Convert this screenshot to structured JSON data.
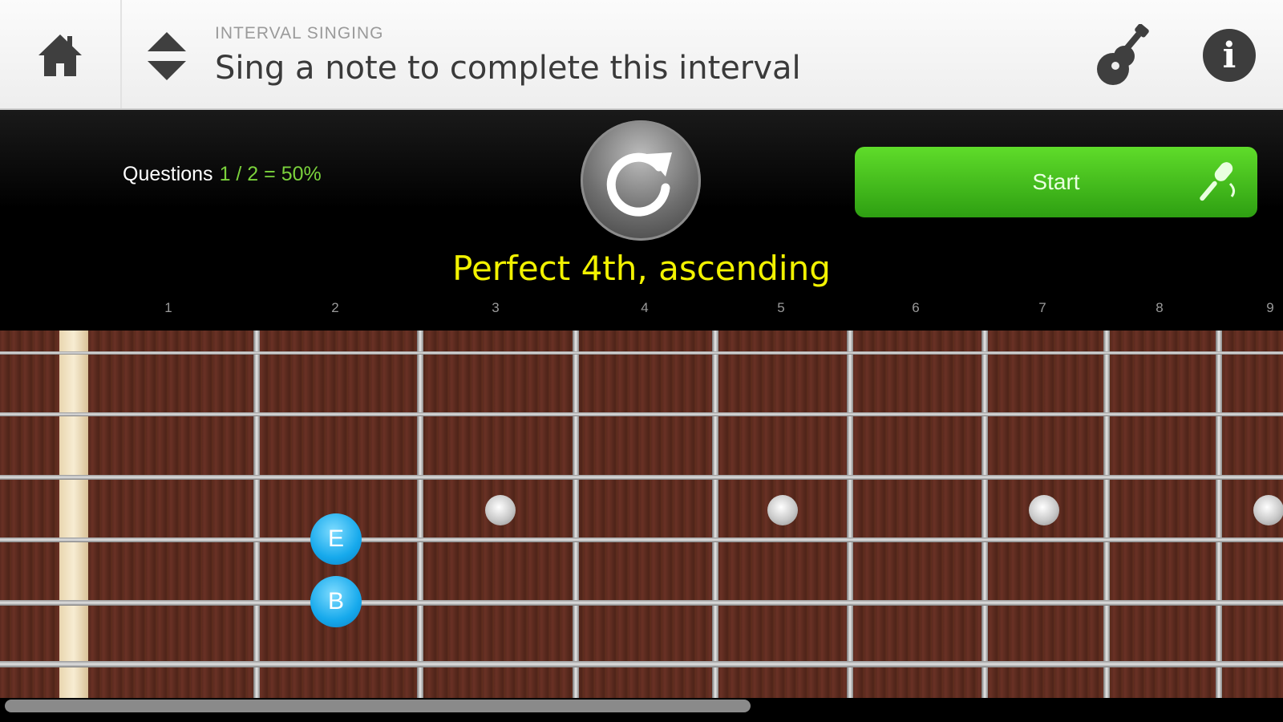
{
  "header": {
    "subtitle": "INTERVAL SINGING",
    "title": "Sing a note to complete this interval",
    "home_icon": "home-icon",
    "updown_icon": "up-down-arrows-icon",
    "guitar_icon": "guitar-icon",
    "info_icon": "info-icon",
    "info_glyph": "i"
  },
  "controls": {
    "questions_label": "Questions",
    "questions_score": "1 / 2 = 50%",
    "replay_icon": "replay-icon",
    "start_label": "Start",
    "mic_icon": "microphone-icon",
    "score_color": "#7bd23c",
    "start_color": "#3bb51a"
  },
  "prompt": {
    "text": "Perfect 4th, ascending",
    "color": "#f2f200"
  },
  "fretboard": {
    "fret_numbers": [
      "1",
      "2",
      "3",
      "4",
      "5",
      "6",
      "7",
      "8",
      "9"
    ],
    "notes": [
      {
        "label": "E",
        "fret": 2,
        "string": 4
      },
      {
        "label": "B",
        "fret": 2,
        "string": 5
      }
    ],
    "inlay_frets": [
      3,
      5,
      7,
      9
    ]
  }
}
